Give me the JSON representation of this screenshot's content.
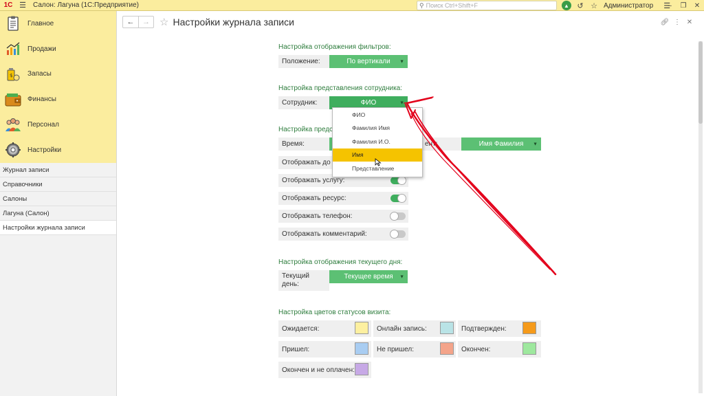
{
  "app": {
    "logo": "1С",
    "title": "Салон: Лагуна  (1С:Предприятие)",
    "search_placeholder": "Поиск Ctrl+Shift+F",
    "user": "Администратор"
  },
  "sidebar": {
    "sections": [
      {
        "label": "Главное",
        "icon": "clipboard-icon"
      },
      {
        "label": "Продажи",
        "icon": "sales-chart-icon"
      },
      {
        "label": "Запасы",
        "icon": "stock-icon"
      },
      {
        "label": "Финансы",
        "icon": "wallet-icon"
      },
      {
        "label": "Персонал",
        "icon": "people-icon"
      },
      {
        "label": "Настройки",
        "icon": "gear-icon"
      }
    ],
    "open_items": [
      "Журнал записи",
      "Справочники",
      "Салоны",
      "Лагуна (Салон)",
      "Настройки журнала записи"
    ]
  },
  "header": {
    "title": "Настройки журнала записи"
  },
  "filters": {
    "title": "Настройка отображения фильтров:",
    "position_label": "Положение:",
    "position_value": "По вертикали"
  },
  "employee": {
    "title": "Настройка представления сотрудника:",
    "label": "Сотрудник:",
    "value": "ФИО",
    "options": [
      "ФИО",
      "Фамилия Имя",
      "Фамилия И.О.",
      "Имя",
      "Представление"
    ],
    "highlighted_index": 3
  },
  "visit": {
    "title": "Настройка предс",
    "time_label": "Время:",
    "client_label_tail": "ент:",
    "client_value": "Имя Фамилия",
    "toggles": [
      {
        "label": "Отображать до",
        "on": true
      },
      {
        "label": "Отображать услугу:",
        "on": true
      },
      {
        "label": "Отображать ресурс:",
        "on": true
      },
      {
        "label": "Отображать телефон:",
        "on": false
      },
      {
        "label": "Отображать комментарий:",
        "on": false
      }
    ]
  },
  "current_day": {
    "title": "Настройка отображения текущего дня:",
    "label_line1": "Текущий",
    "label_line2": "день:",
    "value": "Текущее время"
  },
  "status_colors": {
    "title": "Настройка цветов статусов визита:",
    "items": [
      {
        "label": "Ожидается:",
        "color": "#fdf0a0"
      },
      {
        "label": "Онлайн запись:",
        "color": "#b9e3e6"
      },
      {
        "label": "Подтвержден:",
        "color": "#f59a1a"
      },
      {
        "label": "Пришел:",
        "color": "#a9cdf2"
      },
      {
        "label": "Не пришел:",
        "color": "#f4a48a"
      },
      {
        "label": "Окончен:",
        "color": "#9ee89e"
      },
      {
        "label": "Окончен и не оплачен:",
        "color": "#c7a9e6"
      }
    ]
  },
  "colors": {
    "accent_green": "#5cc074",
    "section_title": "#2e7d3d",
    "sidebar_yellow": "#fbed9e",
    "highlight": "#f5c300",
    "annotation_red": "#e3001b"
  }
}
